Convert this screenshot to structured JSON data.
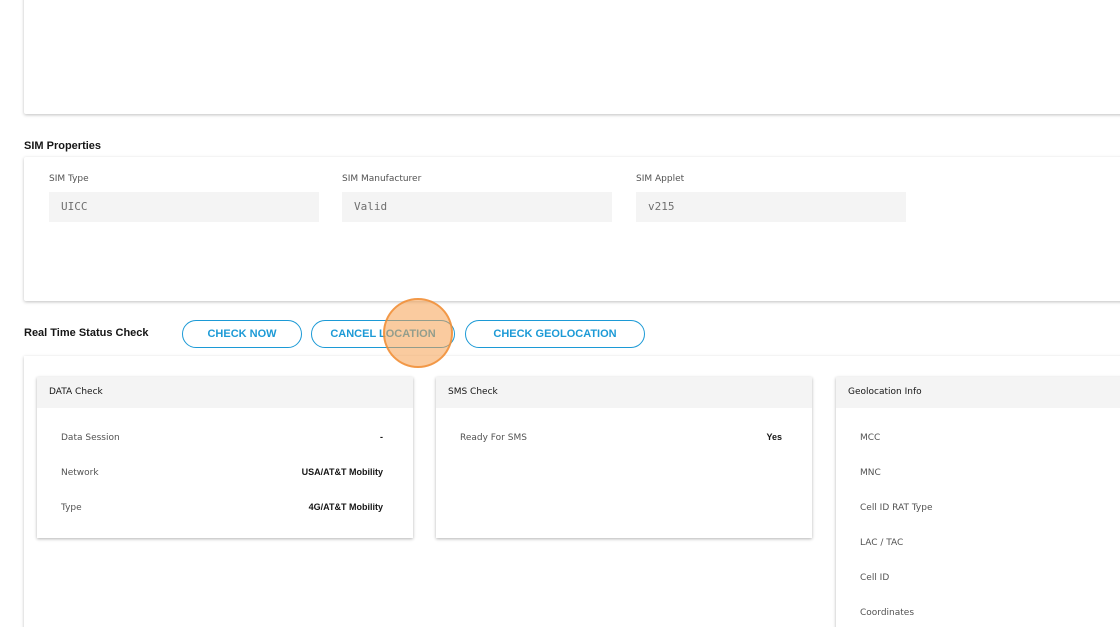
{
  "sim_properties": {
    "title": "SIM Properties",
    "fields": [
      {
        "label": "SIM Type",
        "value": "UICC"
      },
      {
        "label": "SIM Manufacturer",
        "value": "Valid"
      },
      {
        "label": "SIM Applet",
        "value": "v215"
      }
    ]
  },
  "realtime": {
    "title": "Real Time Status Check",
    "buttons": {
      "check_now": "CHECK NOW",
      "cancel_location": "CANCEL LOCATION",
      "check_geolocation": "CHECK GEOLOCATION"
    },
    "accent_color": "#1c9ad6"
  },
  "data_check": {
    "title": "DATA Check",
    "rows": [
      {
        "key": "Data Session",
        "value": "-"
      },
      {
        "key": "Network",
        "value": "USA/AT&T Mobility"
      },
      {
        "key": "Type",
        "value": "4G/AT&T Mobility"
      }
    ]
  },
  "sms_check": {
    "title": "SMS Check",
    "rows": [
      {
        "key": "Ready For SMS",
        "value": "Yes"
      }
    ]
  },
  "geolocation_info": {
    "title": "Geolocation Info",
    "rows": [
      {
        "key": "MCC"
      },
      {
        "key": "MNC"
      },
      {
        "key": "Cell ID RAT Type"
      },
      {
        "key": "LAC / TAC"
      },
      {
        "key": "Cell ID"
      },
      {
        "key": "Coordinates"
      }
    ]
  }
}
